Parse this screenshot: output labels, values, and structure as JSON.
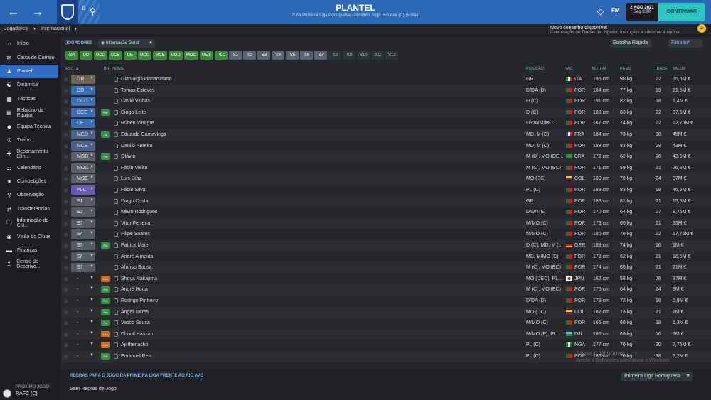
{
  "header": {
    "title": "PLANTEL",
    "subtitle": "7º na Primeira Liga Portuguesa - Próximo Jogo: Rio Ave (C) (5 dias)",
    "fm": "FM",
    "date": "2 AGO 2021",
    "time": "Seg 8:00",
    "continue": "CONTINUAR"
  },
  "tabs": [
    "Jogadores",
    "Internacional"
  ],
  "advice": {
    "title": "Novo conselho disponível",
    "text": "Combinação de Tarefas de Jogador, Instruções a adicionar à equipa",
    "count": "2"
  },
  "sidebar": [
    "Início",
    "Caixa de Correio",
    "Plantel",
    "Dinâmica",
    "Tácticas",
    "Relatório da Equipa",
    "Equipa Técnica",
    "Treino",
    "Departamento Clíni...",
    "Calendário",
    "Competições",
    "Observação",
    "Transferências",
    "Informação do Clu...",
    "Visão do Clube",
    "Finanças",
    "Centro de Desenvo..."
  ],
  "next_match": {
    "label": "PRÓXIMO JOGO",
    "value": "RAFC (C)"
  },
  "toolbar": {
    "section": "JOGADORES",
    "view": "Informação Geral",
    "quick": "Escolha Rápida",
    "filter": "Filtrado*"
  },
  "chips": [
    "GR",
    "DD",
    "DCD",
    "DCE",
    "DE",
    "MCD",
    "MCE",
    "MOD",
    "MOC",
    "MOE",
    "PLC",
    "S1",
    "S2",
    "S3",
    "S4",
    "S5",
    "S6",
    "S7",
    "S8",
    "S9",
    "S10",
    "S11",
    "S12"
  ],
  "columns": {
    "esc": "ESC",
    "inf": "INF",
    "name": "NOME",
    "pos": "POSIÇÃO",
    "nat": "NAC",
    "height": "ALTURA",
    "weight": "PESO",
    "age": "IDADE",
    "value": "VALOR"
  },
  "players": [
    {
      "slot": "GR",
      "inf": "",
      "name": "Gianluigi Donnarumma",
      "pos": "GR",
      "nat": "ITA",
      "h": "196 cm",
      "w": "90 kg",
      "age": "22",
      "val": "35,5M €"
    },
    {
      "slot": "DD",
      "inf": "",
      "name": "Tomás Esteves",
      "pos": "D/DA (D)",
      "nat": "POR",
      "h": "184 cm",
      "w": "77 kg",
      "age": "19",
      "val": "21,5M €"
    },
    {
      "slot": "DCD",
      "inf": "",
      "name": "David Vinhas",
      "pos": "D (C)",
      "nat": "POR",
      "h": "191 cm",
      "w": "82 kg",
      "age": "18",
      "val": "1,4M €"
    },
    {
      "slot": "DCE",
      "inf": "Pré",
      "name": "Diogo Leite",
      "pos": "D (C)",
      "nat": "POR",
      "h": "188 cm",
      "w": "83 kg",
      "age": "22",
      "val": "37,5M €"
    },
    {
      "slot": "DE",
      "inf": "",
      "name": "Rúben Vinagre",
      "pos": "D/DA/M/MO...",
      "nat": "POR",
      "h": "167 cm",
      "w": "74 kg",
      "age": "22",
      "val": "12,75M €"
    },
    {
      "slot": "MCD",
      "inf": "Aj",
      "name": "Eduardo Camavinga",
      "pos": "MD, M (C)",
      "nat": "FRA",
      "h": "184 cm",
      "w": "73 kg",
      "age": "18",
      "val": "45M €"
    },
    {
      "slot": "MCE",
      "inf": "",
      "name": "Danilo Pereira",
      "pos": "MD, M (C)",
      "nat": "POR",
      "h": "188 cm",
      "w": "83 kg",
      "age": "29",
      "val": "43M €"
    },
    {
      "slot": "MOD",
      "inf": "Pré",
      "name": "Otávio",
      "pos": "M (D), MO (DE...",
      "nat": "BRA",
      "h": "172 cm",
      "w": "62 kg",
      "age": "26",
      "val": "43,5M €"
    },
    {
      "slot": "MOC",
      "inf": "",
      "name": "Fábio Vieira",
      "pos": "M (C), MO (EC)",
      "nat": "POR",
      "h": "171 cm",
      "w": "59 kg",
      "age": "21",
      "val": "26,5M €"
    },
    {
      "slot": "MOE",
      "inf": "",
      "name": "Luis Díaz",
      "pos": "MO (EC)",
      "nat": "COL",
      "h": "180 cm",
      "w": "70 kg",
      "age": "24",
      "val": "37M €"
    },
    {
      "slot": "PLC",
      "inf": "",
      "name": "Fábio Silva",
      "pos": "PL (C)",
      "nat": "POR",
      "h": "189 cm",
      "w": "83 kg",
      "age": "19",
      "val": "46,5M €"
    },
    {
      "slot": "S1",
      "inf": "",
      "name": "Diogo Costa",
      "pos": "GR",
      "nat": "POR",
      "h": "186 cm",
      "w": "81 kg",
      "age": "21",
      "val": "15,5M €"
    },
    {
      "slot": "S2",
      "inf": "",
      "name": "Kévin Rodrigues",
      "pos": "D/DA (E)",
      "nat": "POR",
      "h": "170 cm",
      "w": "64 kg",
      "age": "27",
      "val": "8,75M €"
    },
    {
      "slot": "S3",
      "inf": "",
      "name": "Vítor Ferreira",
      "pos": "M/MO (C)",
      "nat": "POR",
      "h": "173 cm",
      "w": "65 kg",
      "age": "21",
      "val": "35M €"
    },
    {
      "slot": "S4",
      "inf": "",
      "name": "Filipe Soares",
      "pos": "M/MO (C)",
      "nat": "POR",
      "h": "180 cm",
      "w": "70 kg",
      "age": "22",
      "val": "17,75M €"
    },
    {
      "slot": "S5",
      "inf": "Pré",
      "name": "Patrick Maier",
      "pos": "D (C), MD, M (...",
      "nat": "GER",
      "h": "189 cm",
      "w": "74 kg",
      "age": "16",
      "val": "1M €"
    },
    {
      "slot": "S6",
      "inf": "",
      "name": "André Almeida",
      "pos": "MD, M/MO (C)",
      "nat": "POR",
      "h": "173 cm",
      "w": "62 kg",
      "age": "21",
      "val": "16,5M €"
    },
    {
      "slot": "S7",
      "inf": "",
      "name": "Afonso Sousa",
      "pos": "M (C), MO (EC)",
      "nat": "POR",
      "h": "174 cm",
      "w": "65 kg",
      "age": "21",
      "val": "21M €"
    },
    {
      "slot": "-",
      "inf": "Lés",
      "name": "Shoya Nakajima",
      "pos": "MO (DEC), PL...",
      "nat": "JPN",
      "h": "162 cm",
      "w": "58 kg",
      "age": "26",
      "val": "37M €"
    },
    {
      "slot": "-",
      "inf": "Pré",
      "name": "André Horta",
      "pos": "M (C), MO (EC)",
      "nat": "POR",
      "h": "176 cm",
      "w": "64 kg",
      "age": "24",
      "val": "9M €"
    },
    {
      "slot": "-",
      "inf": "Pré",
      "name": "Rodrigo Pinheiro",
      "pos": "D/DA (D)",
      "nat": "POR",
      "h": "179 cm",
      "w": "72 kg",
      "age": "18",
      "val": "2,9M €"
    },
    {
      "slot": "-",
      "inf": "Pré",
      "name": "Ángel Torres",
      "pos": "MO (DC)",
      "nat": "COL",
      "h": "182 cm",
      "w": "73 kg",
      "age": "21",
      "val": "2M €"
    },
    {
      "slot": "-",
      "inf": "Pré",
      "name": "Vasco Sousa",
      "pos": "M/MO (C)",
      "nat": "POR",
      "h": "165 cm",
      "w": "60 kg",
      "age": "18",
      "val": "1,3M €"
    },
    {
      "slot": "-",
      "inf": "Lés",
      "name": "Dhouil Hassan",
      "pos": "M/MO (E), PL...",
      "nat": "DJI",
      "h": "186 cm",
      "w": "69 kg",
      "age": "16",
      "val": "2M €"
    },
    {
      "slot": "-",
      "inf": "Lés",
      "name": "Aji Ihenacho",
      "pos": "PL (C)",
      "nat": "NGA",
      "h": "177 cm",
      "w": "70 kg",
      "age": "20",
      "val": "7,75M €"
    },
    {
      "slot": "-",
      "inf": "Pré",
      "name": "Emanuel Reis",
      "pos": "PL (C)",
      "nat": "POR",
      "h": "186 cm",
      "w": "70 kg",
      "age": "18",
      "val": "2,2M €"
    }
  ],
  "rules": {
    "title": "REGRAS PARA O JOGO DA PRIMEIRA LIGA FRENTE AO RIO AVE",
    "text": "Sem Regras de Jogo",
    "competition": "Primeira Liga Portuguesa"
  },
  "watermark": {
    "line1": "Ativar o Windows",
    "line2": "Aceda a Definições para ativar o Windows."
  }
}
